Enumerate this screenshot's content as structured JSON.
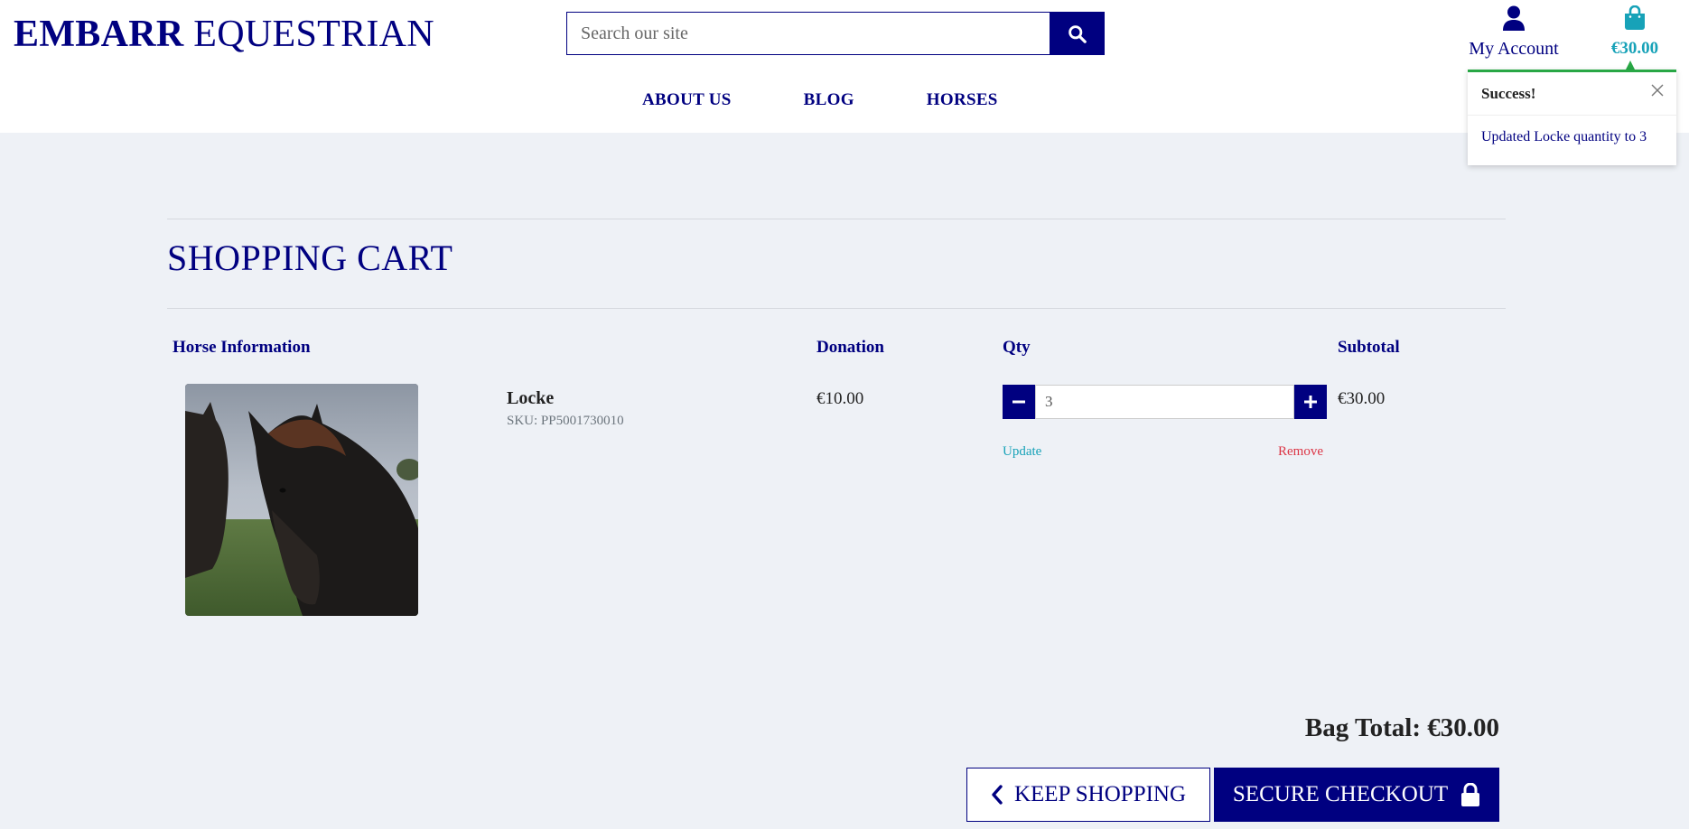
{
  "header": {
    "logo_bold": "EMBARR",
    "logo_regular": "EQUESTRIAN",
    "search_placeholder": "Search our site",
    "account_label": "My Account",
    "bag_total": "€30.00"
  },
  "nav": {
    "items": [
      {
        "label": "ABOUT US"
      },
      {
        "label": "BLOG"
      },
      {
        "label": "HORSES"
      }
    ]
  },
  "toast": {
    "title": "Success!",
    "message": "Updated Locke quantity to 3"
  },
  "cart": {
    "title": "SHOPPING CART",
    "columns": {
      "info": "Horse Information",
      "donation": "Donation",
      "qty": "Qty",
      "subtotal": "Subtotal"
    },
    "items": [
      {
        "name": "Locke",
        "sku": "SKU: PP5001730010",
        "price": "€10.00",
        "quantity": "3",
        "subtotal": "€30.00",
        "update_label": "Update",
        "remove_label": "Remove"
      }
    ],
    "bag_total": "Bag Total: €30.00",
    "keep_shopping": "KEEP SHOPPING",
    "checkout": "SECURE CHECKOUT"
  },
  "colors": {
    "brand": "#000080",
    "accent": "#17a2b8",
    "success": "#28a745",
    "danger": "#dc3545",
    "background": "#eef1f6"
  },
  "icons": [
    "search-icon",
    "user-icon",
    "shopping-bag-icon",
    "close-icon",
    "minus-icon",
    "plus-icon",
    "chevron-left-icon",
    "lock-icon"
  ]
}
